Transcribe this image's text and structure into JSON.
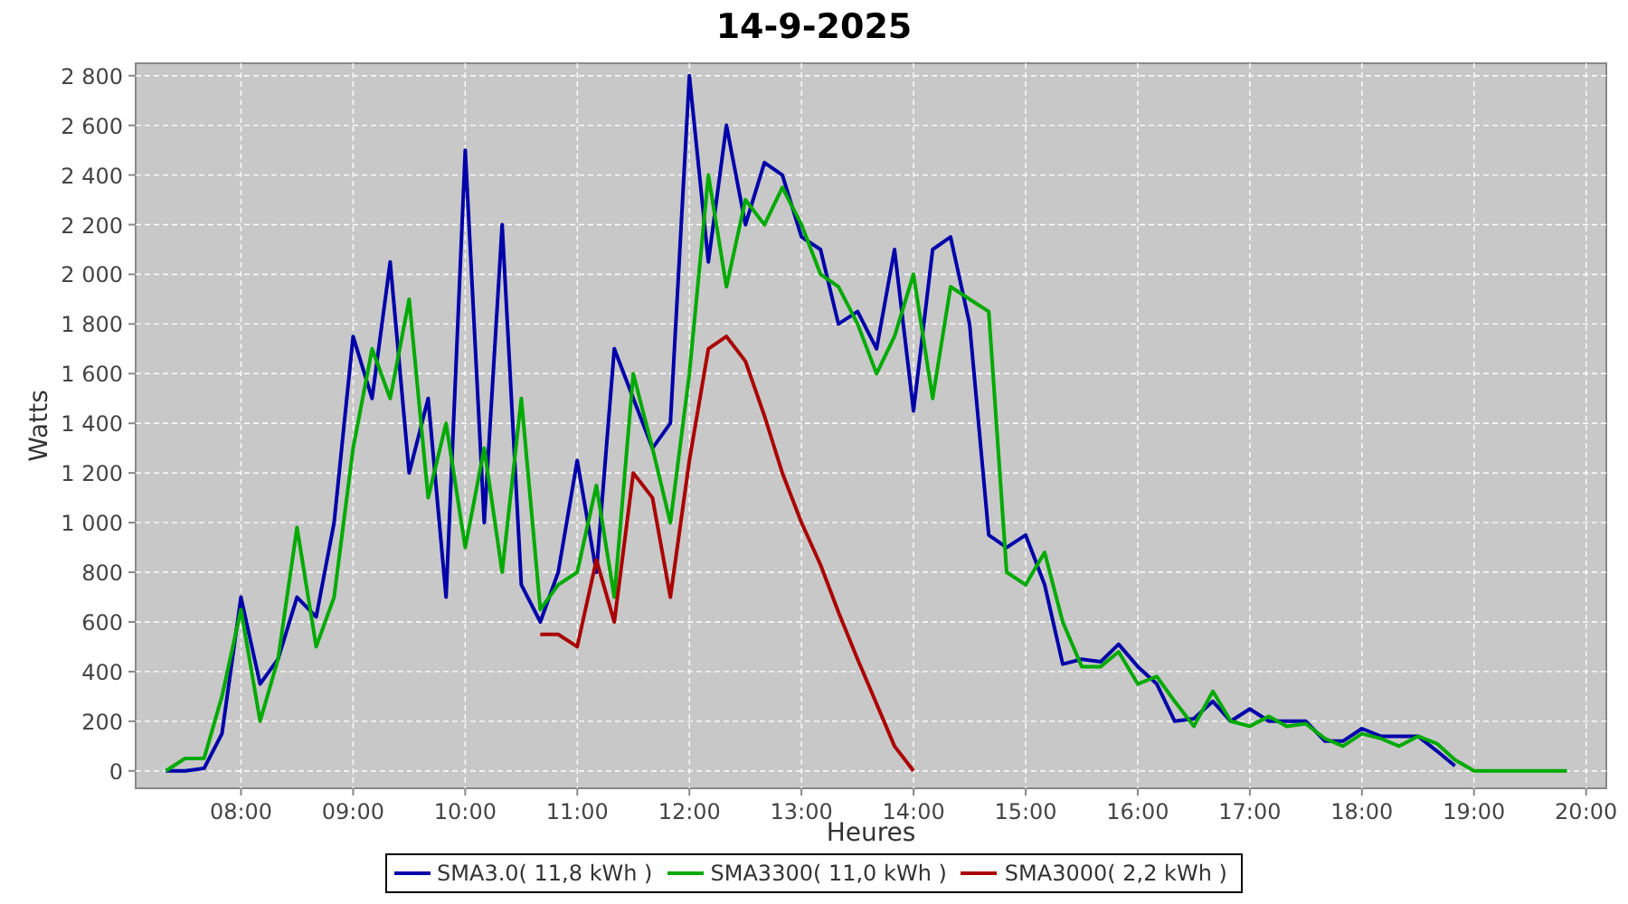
{
  "chart_data": {
    "type": "line",
    "title": "14-9-2025",
    "xlabel": "Heures",
    "ylabel": "Watts",
    "x": [
      7.33,
      7.5,
      7.67,
      7.83,
      8.0,
      8.17,
      8.33,
      8.5,
      8.67,
      8.83,
      9.0,
      9.17,
      9.33,
      9.5,
      9.67,
      9.83,
      10.0,
      10.17,
      10.33,
      10.5,
      10.67,
      10.83,
      11.0,
      11.17,
      11.33,
      11.5,
      11.67,
      11.83,
      12.0,
      12.17,
      12.33,
      12.5,
      12.67,
      12.83,
      13.0,
      13.17,
      13.33,
      13.5,
      13.67,
      13.83,
      14.0,
      14.17,
      14.33,
      14.5,
      14.67,
      14.83,
      15.0,
      15.17,
      15.33,
      15.5,
      15.67,
      15.83,
      16.0,
      16.17,
      16.33,
      16.5,
      16.67,
      16.83,
      17.0,
      17.17,
      17.33,
      17.5,
      17.67,
      17.83,
      18.0,
      18.17,
      18.33,
      18.5,
      18.67,
      18.83,
      19.0,
      19.17,
      19.33,
      19.5,
      19.67,
      19.83
    ],
    "series": [
      {
        "name": "SMA3.0( 11,8 kWh )",
        "color": "#0000aa",
        "values": [
          0,
          0,
          10,
          150,
          700,
          350,
          450,
          700,
          620,
          1000,
          1750,
          1500,
          2050,
          1200,
          1500,
          700,
          2500,
          1000,
          2200,
          750,
          600,
          800,
          1250,
          800,
          1700,
          1500,
          1300,
          1400,
          2800,
          2050,
          2600,
          2200,
          2450,
          2400,
          2150,
          2100,
          1800,
          1850,
          1700,
          2100,
          1450,
          2100,
          2150,
          1800,
          950,
          900,
          950,
          750,
          430,
          450,
          440,
          510,
          420,
          350,
          200,
          210,
          280,
          200,
          250,
          200,
          200,
          200,
          120,
          120,
          170,
          140,
          140,
          140,
          80,
          20,
          null,
          null,
          null,
          null,
          null,
          null
        ]
      },
      {
        "name": "SMA3300( 11,0 kWh )",
        "color": "#00aa00",
        "values": [
          0,
          50,
          50,
          300,
          650,
          200,
          450,
          980,
          500,
          700,
          1300,
          1700,
          1500,
          1900,
          1100,
          1400,
          900,
          1300,
          800,
          1500,
          650,
          750,
          800,
          1150,
          700,
          1600,
          1300,
          1000,
          1600,
          2400,
          1950,
          2300,
          2200,
          2350,
          2200,
          2000,
          1950,
          1800,
          1600,
          1750,
          2000,
          1500,
          1950,
          1900,
          1850,
          800,
          750,
          880,
          600,
          420,
          420,
          480,
          350,
          380,
          280,
          180,
          320,
          200,
          180,
          220,
          180,
          190,
          130,
          100,
          150,
          130,
          100,
          140,
          110,
          45,
          0,
          0,
          0,
          0,
          0,
          0
        ]
      },
      {
        "name": "SMA3000( 2,2 kWh )",
        "color": "#aa0000",
        "values": [
          null,
          null,
          null,
          null,
          null,
          null,
          null,
          null,
          null,
          null,
          null,
          null,
          null,
          null,
          null,
          null,
          null,
          null,
          null,
          null,
          550,
          550,
          500,
          850,
          600,
          1200,
          1100,
          700,
          1250,
          1700,
          1750,
          1650,
          1430,
          1200,
          1000,
          830,
          640,
          450,
          270,
          100,
          0,
          null,
          null,
          null,
          null,
          null,
          null,
          null,
          null,
          null,
          null,
          null,
          null,
          null,
          null,
          null,
          null,
          null,
          null,
          null,
          null,
          null,
          null,
          null,
          null,
          null,
          null,
          null,
          null,
          null,
          null,
          null,
          null,
          null,
          null,
          null
        ]
      }
    ],
    "grid": true,
    "xlim": [
      7.06,
      20.18
    ],
    "ylim": [
      -70,
      2850
    ],
    "xticks": [
      {
        "value": 8,
        "label": "08:00"
      },
      {
        "value": 9,
        "label": "09:00"
      },
      {
        "value": 10,
        "label": "10:00"
      },
      {
        "value": 11,
        "label": "11:00"
      },
      {
        "value": 12,
        "label": "12:00"
      },
      {
        "value": 13,
        "label": "13:00"
      },
      {
        "value": 14,
        "label": "14:00"
      },
      {
        "value": 15,
        "label": "15:00"
      },
      {
        "value": 16,
        "label": "16:00"
      },
      {
        "value": 17,
        "label": "17:00"
      },
      {
        "value": 18,
        "label": "18:00"
      },
      {
        "value": 19,
        "label": "19:00"
      },
      {
        "value": 20,
        "label": "20:00"
      }
    ],
    "yticks": [
      {
        "value": 0,
        "label": "0"
      },
      {
        "value": 200,
        "label": "200"
      },
      {
        "value": 400,
        "label": "400"
      },
      {
        "value": 600,
        "label": "600"
      },
      {
        "value": 800,
        "label": "800"
      },
      {
        "value": 1000,
        "label": "1 000"
      },
      {
        "value": 1200,
        "label": "1 200"
      },
      {
        "value": 1400,
        "label": "1 400"
      },
      {
        "value": 1600,
        "label": "1 600"
      },
      {
        "value": 1800,
        "label": "1 800"
      },
      {
        "value": 2000,
        "label": "2 000"
      },
      {
        "value": 2200,
        "label": "2 200"
      },
      {
        "value": 2400,
        "label": "2 400"
      },
      {
        "value": 2600,
        "label": "2 600"
      },
      {
        "value": 2800,
        "label": "2 800"
      }
    ]
  }
}
